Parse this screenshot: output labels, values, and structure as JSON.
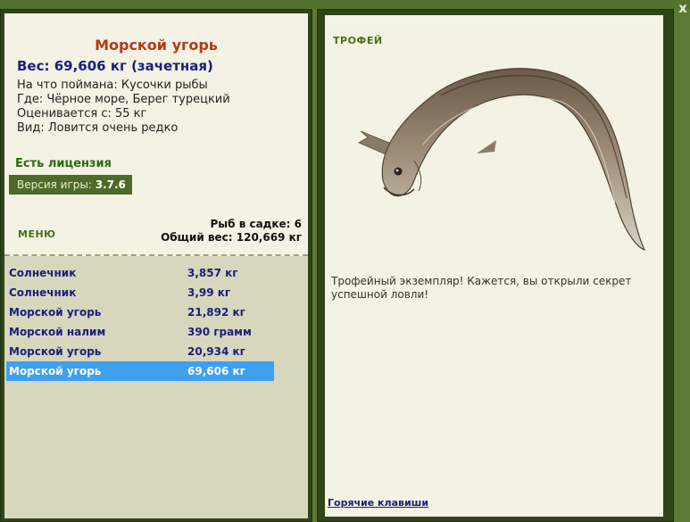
{
  "close_label": "x",
  "fish": {
    "title": "Морской угорь",
    "weight": "Вес: 69,606 кг (зачетная)",
    "bait": "На что поймана: Кусочки рыбы",
    "location": "Где: Чёрное море, Берег турецкий",
    "valued": "Оценивается с: 55 кг",
    "kind": "Вид: Ловится очень редко"
  },
  "license": "Есть лицензия",
  "version": {
    "label": "Версия игры:",
    "value": "3.7.6"
  },
  "menu_label": "МЕНЮ",
  "stats": {
    "fish_count": "Рыб в садке: 6",
    "total_weight": "Общий вес: 120,669 кг"
  },
  "catch_list": [
    {
      "name": "Солнечник",
      "weight": "3,857 кг",
      "selected": false
    },
    {
      "name": "Солнечник",
      "weight": "3,99 кг",
      "selected": false
    },
    {
      "name": "Морской угорь",
      "weight": "21,892 кг",
      "selected": false
    },
    {
      "name": "Морской налим",
      "weight": "390 грамм",
      "selected": false
    },
    {
      "name": "Морской угорь",
      "weight": "20,934 кг",
      "selected": false
    },
    {
      "name": "Морской угорь",
      "weight": "69,606 кг",
      "selected": true
    }
  ],
  "trophy": {
    "label": "ТРОФЕЙ",
    "text": "Трофейный экземпляр! Кажется, вы открыли секрет успешной ловли!"
  },
  "hotkeys_label": "Горячие клавиши",
  "colors": {
    "frame_green": "#5c7a36",
    "panel_bg": "#f3f2e4",
    "title_red": "#b23b14",
    "navy": "#1b1e7a",
    "selection_blue": "#3fa0f0",
    "list_bg": "#d7d7bd"
  }
}
